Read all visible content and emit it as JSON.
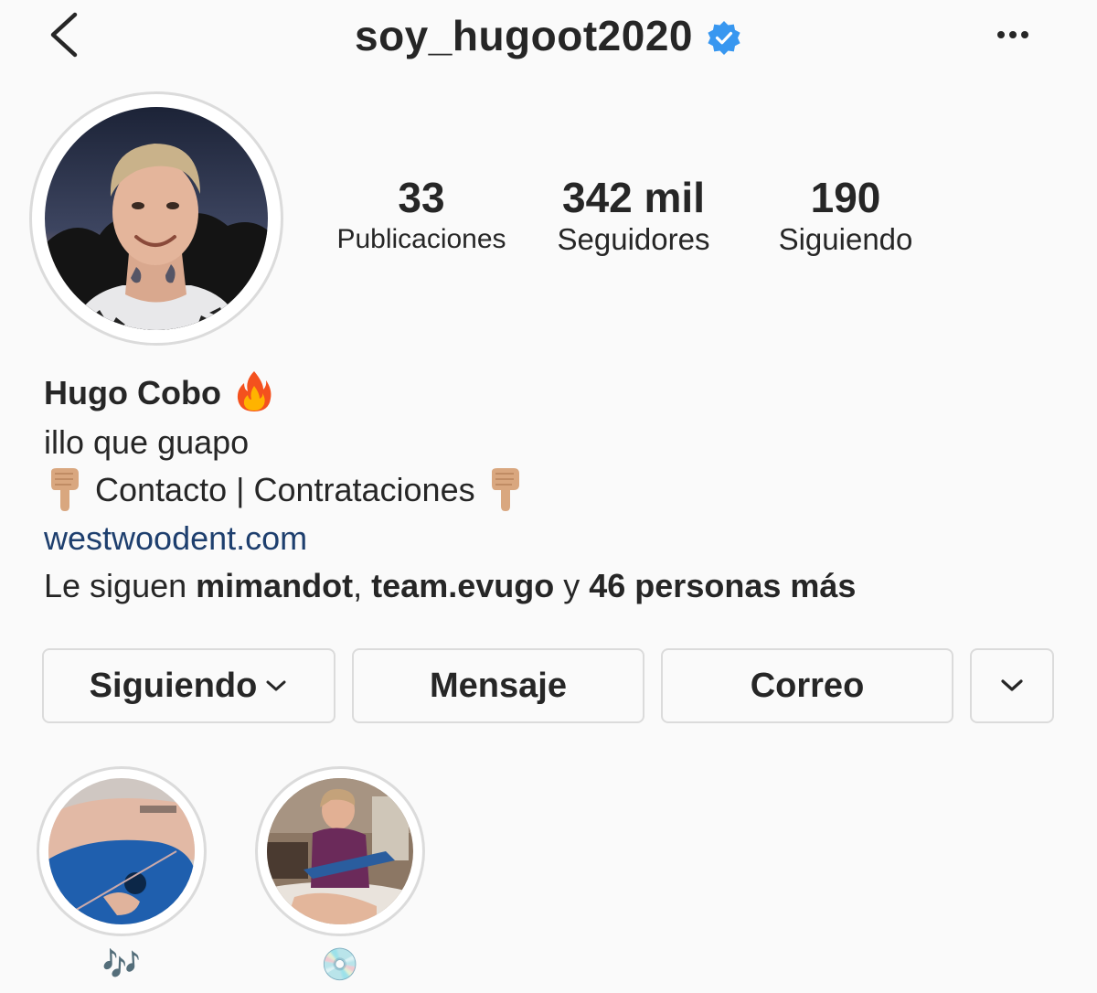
{
  "header": {
    "username": "soy_hugoot2020",
    "verified": true,
    "back_icon": "chevron-left-icon",
    "more_icon": "more-horizontal-icon"
  },
  "stats": [
    {
      "value": "33",
      "label": "Publicaciones"
    },
    {
      "value": "342 mil",
      "label": "Seguidores"
    },
    {
      "value": "190",
      "label": "Siguiendo"
    }
  ],
  "bio": {
    "name": "Hugo Cobo",
    "name_emoji": "fire-emoji",
    "text": "illo que guapo",
    "contact_text": "Contacto | Contrataciones",
    "contact_emoji": "pointing-down-emoji",
    "link": "westwoodent.com",
    "followed_prefix": "Le siguen ",
    "followed_user1": "mimandot",
    "followed_sep1": ", ",
    "followed_user2": "team.evugo",
    "followed_sep2": " y ",
    "followed_rest": "46 personas más"
  },
  "buttons": {
    "following": "Siguiendo",
    "message": "Mensaje",
    "email": "Correo"
  },
  "highlights": [
    {
      "label": "🎶",
      "icon": "music-notes-emoji"
    },
    {
      "label": "💿",
      "icon": "cd-emoji"
    }
  ],
  "colors": {
    "background": "#fafafa",
    "text": "#262626",
    "link": "#1e3f6e",
    "verified": "#3897f0",
    "border": "#dbdbdb"
  }
}
